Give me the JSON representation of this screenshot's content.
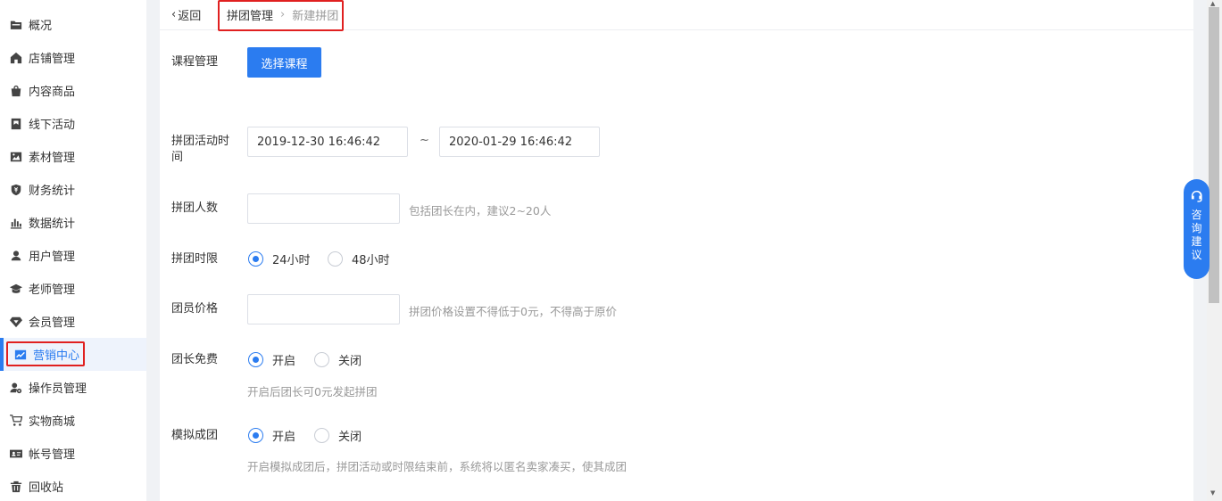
{
  "sidebar": {
    "items": [
      {
        "label": "概况",
        "icon": "folder-icon"
      },
      {
        "label": "店铺管理",
        "icon": "home-icon"
      },
      {
        "label": "内容商品",
        "icon": "bag-icon"
      },
      {
        "label": "线下活动",
        "icon": "flag-icon"
      },
      {
        "label": "素材管理",
        "icon": "image-icon"
      },
      {
        "label": "财务统计",
        "icon": "shield-money-icon"
      },
      {
        "label": "数据统计",
        "icon": "bar-chart-icon"
      },
      {
        "label": "用户管理",
        "icon": "user-icon"
      },
      {
        "label": "老师管理",
        "icon": "graduation-cap-icon"
      },
      {
        "label": "会员管理",
        "icon": "diamond-icon"
      },
      {
        "label": "营销中心",
        "icon": "trend-chart-icon",
        "active": true
      },
      {
        "label": "操作员管理",
        "icon": "user-gear-icon"
      },
      {
        "label": "实物商城",
        "icon": "cart-icon"
      },
      {
        "label": "帐号管理",
        "icon": "id-card-icon"
      },
      {
        "label": "回收站",
        "icon": "trash-icon"
      }
    ]
  },
  "topbar": {
    "back_label": "返回",
    "breadcrumb": {
      "parent": "拼团管理",
      "current": "新建拼团"
    }
  },
  "form": {
    "course": {
      "label": "课程管理",
      "button": "选择课程"
    },
    "activity_time": {
      "label": "拼团活动时间",
      "start": "2019-12-30 16:46:42",
      "separator": "~",
      "end": "2020-01-29 16:46:42"
    },
    "group_size": {
      "label": "拼团人数",
      "value": "",
      "hint": "包括团长在内，建议2~20人"
    },
    "time_limit": {
      "label": "拼团时限",
      "options": [
        "24小时",
        "48小时"
      ],
      "selected": 0
    },
    "member_price": {
      "label": "团员价格",
      "value": "",
      "hint": "拼团价格设置不得低于0元，不得高于原价"
    },
    "leader_free": {
      "label": "团长免费",
      "options": [
        "开启",
        "关闭"
      ],
      "selected": 0,
      "hint": "开启后团长可0元发起拼团"
    },
    "simulated_group": {
      "label": "模拟成团",
      "options": [
        "开启",
        "关闭"
      ],
      "selected": 0,
      "hint": "开启模拟成团后，拼团活动或时限结束前，系统将以匿名卖家凑买，使其成团"
    }
  },
  "consult": {
    "label": "咨询建议",
    "icon": "headset-icon"
  },
  "colors": {
    "accent": "#2b7cf0",
    "highlight_box": "#e02020"
  }
}
